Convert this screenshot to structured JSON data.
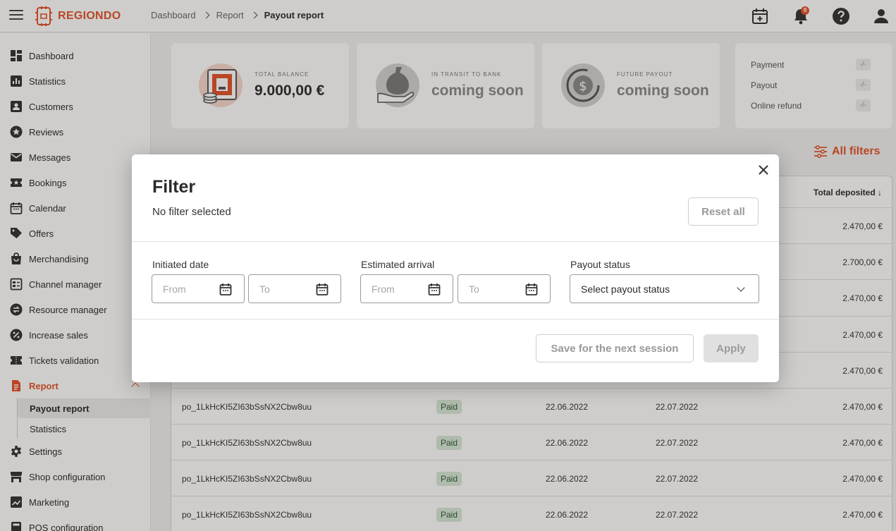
{
  "app": {
    "logo_text": "REGIONDO"
  },
  "header": {
    "breadcrumb": [
      "Dashboard",
      "Report",
      "Payout report"
    ],
    "notification_count": "9"
  },
  "sidebar": {
    "items": [
      {
        "label": "Dashboard"
      },
      {
        "label": "Statistics"
      },
      {
        "label": "Customers"
      },
      {
        "label": "Reviews"
      },
      {
        "label": "Messages"
      },
      {
        "label": "Bookings"
      },
      {
        "label": "Calendar"
      },
      {
        "label": "Offers"
      },
      {
        "label": "Merchandising"
      },
      {
        "label": "Channel manager"
      },
      {
        "label": "Resource manager"
      },
      {
        "label": "Increase sales"
      },
      {
        "label": "Tickets validation"
      },
      {
        "label": "Report"
      },
      {
        "label": "Settings"
      },
      {
        "label": "Shop configuration"
      },
      {
        "label": "Marketing"
      },
      {
        "label": "POS configuration"
      }
    ],
    "report_sub": [
      "Payout report",
      "Statistics"
    ]
  },
  "cards": {
    "total_balance": {
      "label": "TOTAL BALANCE",
      "value": "9.000,00 €"
    },
    "in_transit": {
      "label": "IN TRANSIT TO BANK",
      "value": "coming soon"
    },
    "future_payout": {
      "label": "FUTURE PAYOUT",
      "value": "coming soon"
    },
    "summary": [
      {
        "label": "Payment",
        "value": "-/-"
      },
      {
        "label": "Payout",
        "value": "-/-"
      },
      {
        "label": "Online refund",
        "value": "-/-"
      }
    ]
  },
  "main": {
    "all_filters_label": "All filters",
    "table": {
      "total_header": "Total deposited",
      "amounts_top": [
        "2.470,00 €",
        "2.700,00 €",
        "2.470,00 €",
        "2.470,00 €",
        "2.470,00 €"
      ],
      "rows": [
        {
          "id": "po_1LkHcKI5ZI63bSsNX2Cbw8uu",
          "status": "Paid",
          "initiated": "22.06.2022",
          "arrival": "22.07.2022",
          "amount": "2.470,00 €"
        },
        {
          "id": "po_1LkHcKI5ZI63bSsNX2Cbw8uu",
          "status": "Paid",
          "initiated": "22.06.2022",
          "arrival": "22.07.2022",
          "amount": "2.470,00 €"
        },
        {
          "id": "po_1LkHcKI5ZI63bSsNX2Cbw8uu",
          "status": "Paid",
          "initiated": "22.06.2022",
          "arrival": "22.07.2022",
          "amount": "2.470,00 €"
        },
        {
          "id": "po_1LkHcKI5ZI63bSsNX2Cbw8uu",
          "status": "Paid",
          "initiated": "22.06.2022",
          "arrival": "22.07.2022",
          "amount": "2.470,00 €"
        }
      ]
    }
  },
  "modal": {
    "title": "Filter",
    "subtitle": "No filter selected",
    "reset_label": "Reset all",
    "initiated_label": "Initiated date",
    "arrival_label": "Estimated arrival",
    "status_label": "Payout status",
    "from_placeholder": "From",
    "to_placeholder": "To",
    "status_value": "Select payout status",
    "save_label": "Save for the next session",
    "apply_label": "Apply"
  },
  "colors": {
    "accent": "#e2532b",
    "paid_bg": "#d7e8d9"
  }
}
